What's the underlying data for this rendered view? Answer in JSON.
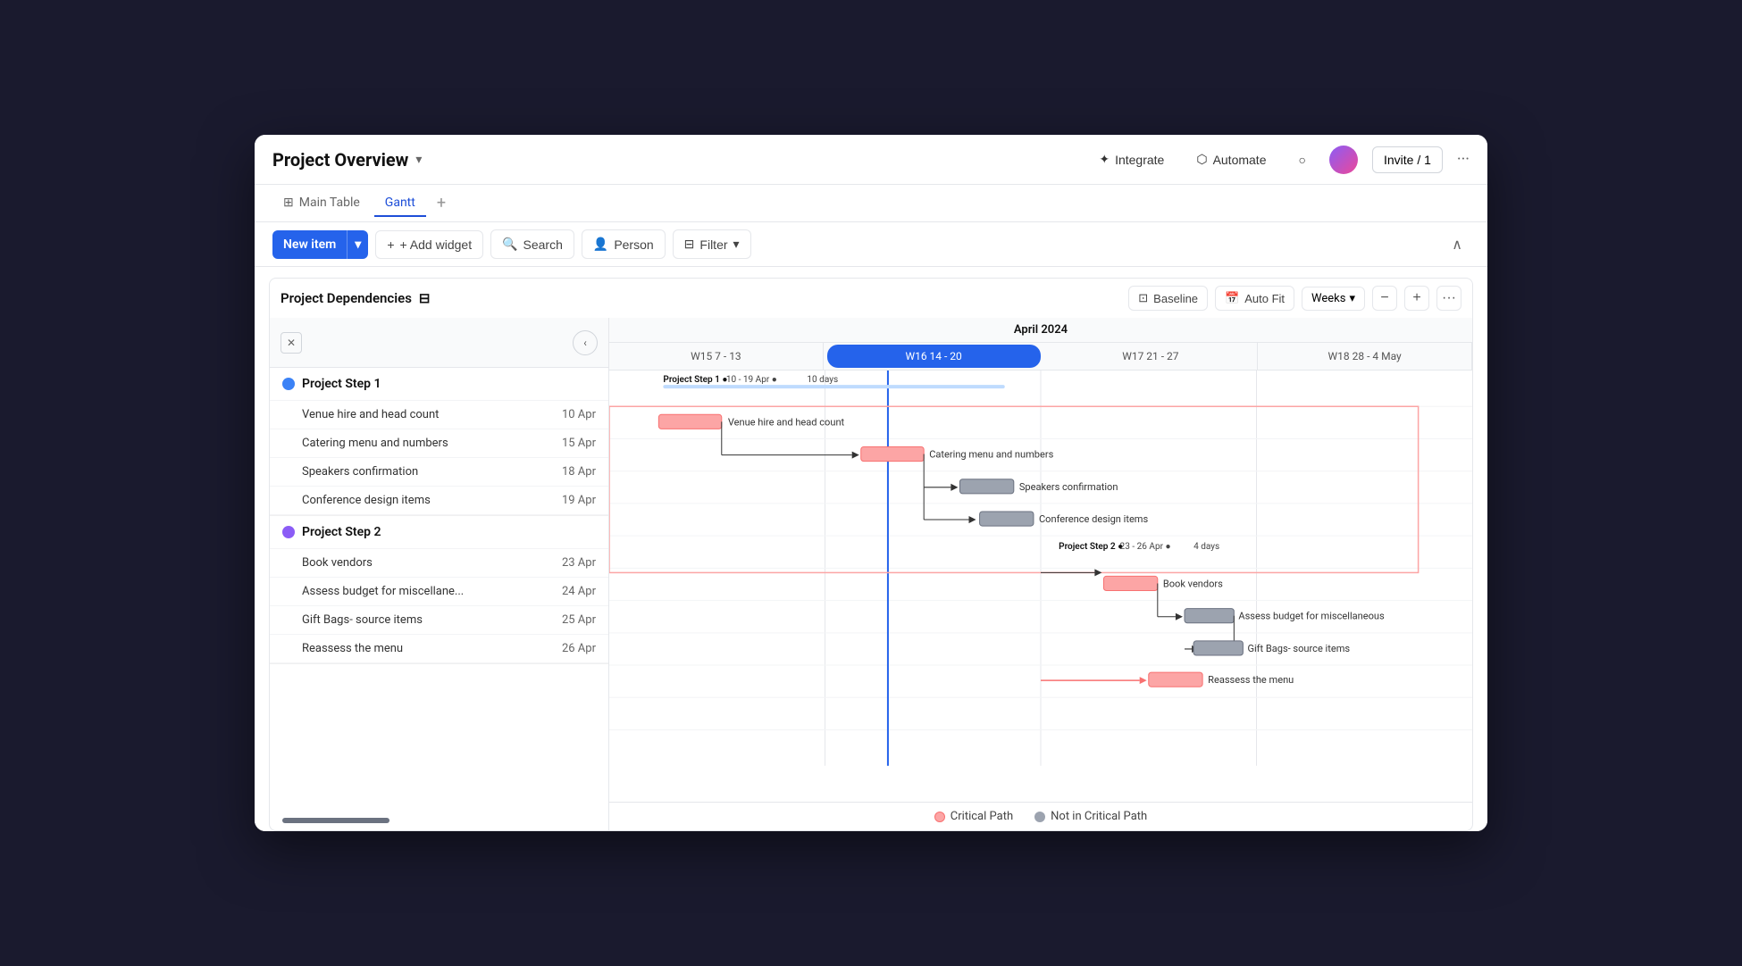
{
  "window": {
    "title": "Project Overview"
  },
  "header": {
    "title": "Project Overview",
    "chevron": "▾",
    "integrate_label": "Integrate",
    "automate_label": "Automate",
    "invite_label": "Invite / 1",
    "more_label": "···"
  },
  "tabs": {
    "main_table": "Main Table",
    "gantt": "Gantt",
    "add": "+"
  },
  "toolbar": {
    "new_item": "New item",
    "add_widget": "+ Add widget",
    "search": "Search",
    "person": "Person",
    "filter": "Filter",
    "filter_arrow": "▾",
    "collapse_icon": "∧"
  },
  "gantt": {
    "title": "Project Dependencies",
    "filter_icon": "⊟",
    "baseline": "Baseline",
    "auto_fit": "Auto Fit",
    "weeks": "Weeks",
    "month": "April 2024",
    "weeks_list": [
      {
        "label": "W15 7 - 13",
        "current": false
      },
      {
        "label": "W16 14 - 20",
        "current": true
      },
      {
        "label": "W17 21 - 27",
        "current": false
      },
      {
        "label": "W18 28 - 4 May",
        "current": false
      }
    ]
  },
  "project1": {
    "label": "Project Step 1",
    "color": "blue",
    "summary": "Project Step 1 ● 10 - 19 Apr ● 10 days",
    "tasks": [
      {
        "name": "Venue hire and head count",
        "date": "10 Apr"
      },
      {
        "name": "Catering menu and numbers",
        "date": "15 Apr"
      },
      {
        "name": "Speakers confirmation",
        "date": "18 Apr"
      },
      {
        "name": "Conference design items",
        "date": "19 Apr"
      }
    ]
  },
  "project2": {
    "label": "Project Step 2",
    "color": "purple",
    "summary": "Project Step 2 ● 23 - 26 Apr ● 4 days",
    "tasks": [
      {
        "name": "Book vendors",
        "date": "23 Apr"
      },
      {
        "name": "Assess budget for miscellane...",
        "date": "24 Apr"
      },
      {
        "name": "Gift Bags- source items",
        "date": "25 Apr"
      },
      {
        "name": "Reassess the menu",
        "date": "26 Apr"
      }
    ]
  },
  "legend": {
    "critical": "Critical Path",
    "not_critical": "Not in Critical Path"
  }
}
